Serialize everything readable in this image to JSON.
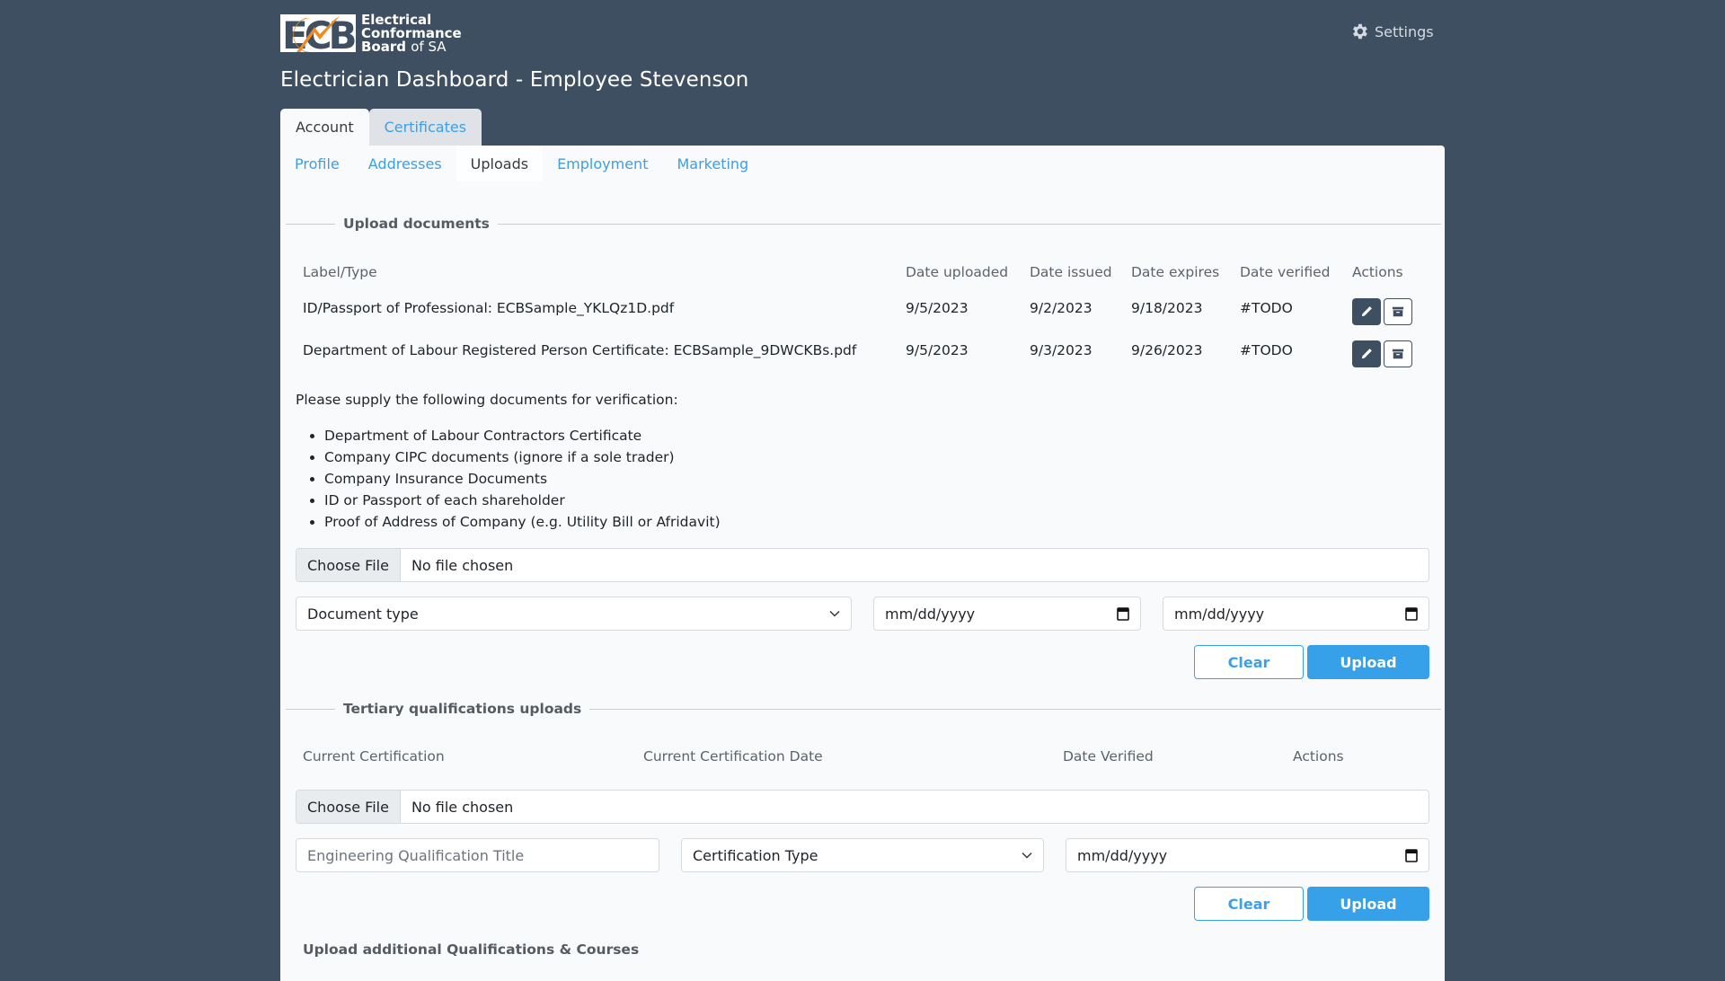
{
  "header": {
    "logo_mark": "ECB",
    "logo_lines": [
      "Electrical",
      "Conformance",
      "Board"
    ],
    "logo_suffix": "of SA",
    "settings_label": "Settings",
    "page_title": "Electrician Dashboard - Employee Stevenson"
  },
  "main_tabs": [
    {
      "label": "Account",
      "active": true
    },
    {
      "label": "Certificates",
      "active": false
    }
  ],
  "sub_tabs": [
    {
      "label": "Profile",
      "active": false
    },
    {
      "label": "Addresses",
      "active": false
    },
    {
      "label": "Uploads",
      "active": true
    },
    {
      "label": "Employment",
      "active": false
    },
    {
      "label": "Marketing",
      "active": false
    }
  ],
  "upload_documents": {
    "legend": "Upload documents",
    "columns": [
      "Label/Type",
      "Date uploaded",
      "Date issued",
      "Date expires",
      "Date verified",
      "Actions"
    ],
    "rows": [
      {
        "label": "ID/Passport of Professional: ECBSample_YKLQz1D.pdf",
        "uploaded": "9/5/2023",
        "issued": "9/2/2023",
        "expires": "9/18/2023",
        "verified": "#TODO"
      },
      {
        "label": "Department of Labour Registered Person Certificate: ECBSample_9DWCKBs.pdf",
        "uploaded": "9/5/2023",
        "issued": "9/3/2023",
        "expires": "9/26/2023",
        "verified": "#TODO"
      }
    ],
    "instructions": "Please supply the following documents for verification:",
    "required_docs": [
      "Department of Labour Contractors Certificate",
      "Company CIPC documents (ignore if a sole trader)",
      "Company Insurance Documents",
      "ID or Passport of each shareholder",
      "Proof of Address of Company (e.g. Utility Bill or Afridavit)"
    ],
    "file_button": "Choose File",
    "file_status": "No file chosen",
    "document_type_select": "Document type",
    "date_issued_placeholder": "mm/dd/yyyy",
    "date_expires_placeholder": "mm/dd/yyyy",
    "clear_label": "Clear",
    "upload_label": "Upload"
  },
  "tertiary": {
    "legend": "Tertiary qualifications uploads",
    "columns": [
      "Current Certification",
      "Current Certification Date",
      "Date Verified",
      "Actions"
    ],
    "file_button": "Choose File",
    "file_status": "No file chosen",
    "title_placeholder": "Engineering Qualification Title",
    "certification_type_select": "Certification Type",
    "date_placeholder": "mm/dd/yyyy",
    "clear_label": "Clear",
    "upload_label": "Upload"
  },
  "additional": {
    "heading": "Upload additional Qualifications & Courses"
  },
  "colors": {
    "background": "#3f4f62",
    "accent": "#36a0e9",
    "logo_orange": "#f08a24"
  }
}
